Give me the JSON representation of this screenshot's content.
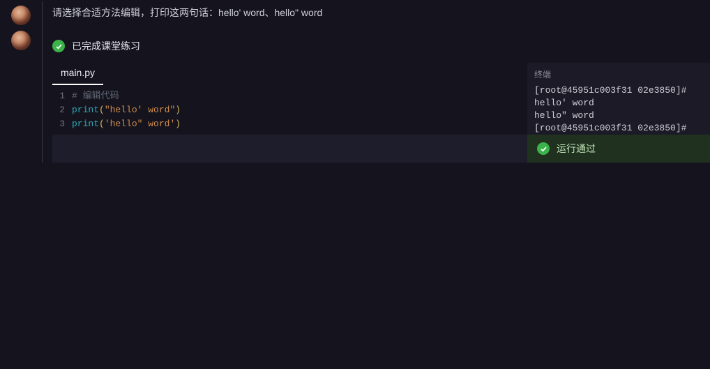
{
  "prompt": {
    "text": "请选择合适方法编辑，打印这两句话：hello' word、hello\" word"
  },
  "status": {
    "completed_label": "已完成课堂练习"
  },
  "editor": {
    "filename": "main.py",
    "lines": [
      {
        "n": "1",
        "comment": "# 编辑代码"
      },
      {
        "n": "2",
        "fn": "print",
        "open": "(",
        "str": "\"hello' word\"",
        "close": ")"
      },
      {
        "n": "3",
        "fn": "print",
        "open": "(",
        "str": "'hello\" word'",
        "close": ")"
      }
    ]
  },
  "terminal": {
    "title": "终端",
    "lines": [
      "[root@45951c003f31 02e3850]#",
      "hello' word",
      "hello\" word",
      "[root@45951c003f31 02e3850]#"
    ],
    "pass_label": "运行通过"
  }
}
